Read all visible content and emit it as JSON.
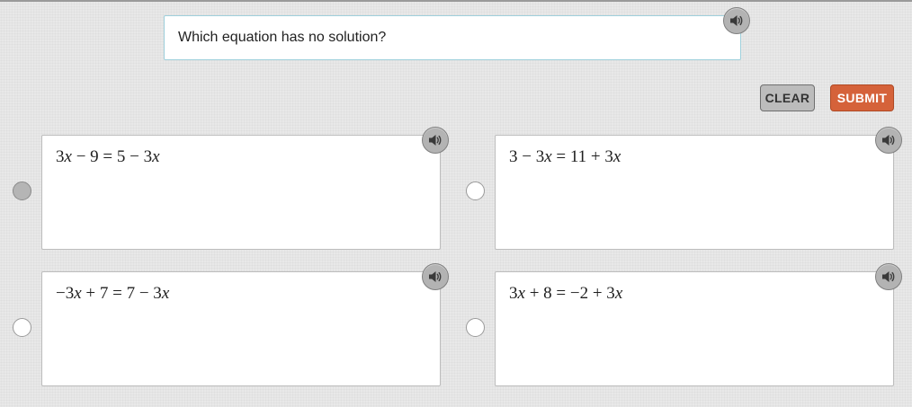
{
  "question": {
    "text": "Which equation has no solution?",
    "audio_icon": "speaker-icon"
  },
  "actions": {
    "clear_label": "CLEAR",
    "submit_label": "SUBMIT",
    "submit_color": "#d5623a"
  },
  "options": [
    {
      "equation": "3x − 9 = 5 − 3x",
      "selected": true,
      "audio_icon": "speaker-icon"
    },
    {
      "equation": "3 − 3x = 11 + 3x",
      "selected": false,
      "audio_icon": "speaker-icon"
    },
    {
      "equation": "−3x + 7 = 7 − 3x",
      "selected": false,
      "audio_icon": "speaker-icon"
    },
    {
      "equation": "3x + 8 = −2 + 3x",
      "selected": false,
      "audio_icon": "speaker-icon"
    }
  ]
}
